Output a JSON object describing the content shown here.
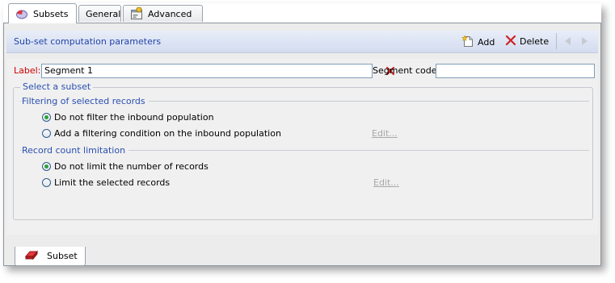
{
  "tabs": [
    {
      "label": "Subsets",
      "icon": "subsets-icon"
    },
    {
      "label": "General"
    },
    {
      "label": "Advanced",
      "icon": "advanced-settings-icon"
    }
  ],
  "toolbar": {
    "title": "Sub-set computation parameters",
    "add_label": "Add",
    "delete_label": "Delete"
  },
  "form": {
    "label_caption": "Label:",
    "label_value": "Segment 1",
    "segment_code_caption": "Segment code:",
    "segment_code_value": ""
  },
  "select_subset": {
    "legend": "Select a subset",
    "filtering": {
      "heading": "Filtering of selected records",
      "options": [
        {
          "label": "Do not filter the inbound population",
          "checked": true
        },
        {
          "label": "Add a filtering condition on the inbound population",
          "checked": false
        }
      ],
      "edit_label": "Edit..."
    },
    "count_limit": {
      "heading": "Record count limitation",
      "options": [
        {
          "label": "Do not limit the number of records",
          "checked": true
        },
        {
          "label": "Limit the selected records",
          "checked": false
        }
      ],
      "edit_label": "Edit..."
    }
  },
  "bottom_tab": {
    "label": "Subset"
  },
  "colors": {
    "label_required": "#cc0000",
    "section_heading": "#2a4fb0",
    "toolbar_title": "#2244aa",
    "radio_checked": "#2ea13a",
    "delete_red": "#cc2222"
  }
}
